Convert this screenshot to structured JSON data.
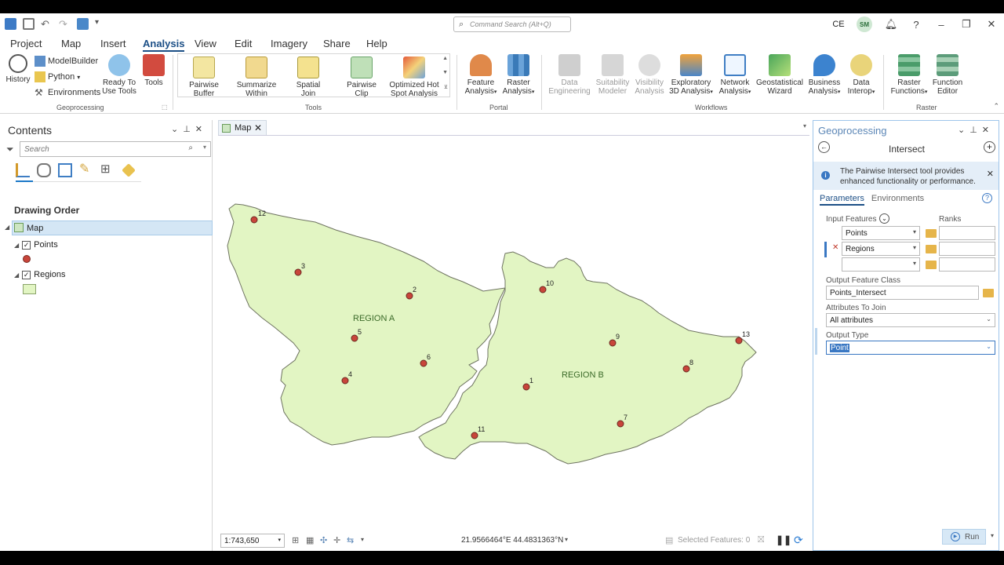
{
  "title_bar": {
    "command_search_placeholder": "Command Search (Alt+Q)",
    "user_initials": "CE",
    "avatar_initials": "SM",
    "icons": [
      "new-project-icon",
      "save-icon",
      "undo-icon",
      "redo-icon",
      "share-icon",
      "customize-icon",
      "notifications-icon",
      "help-icon",
      "minimize-icon",
      "restore-icon",
      "close-icon"
    ]
  },
  "menu": [
    "Project",
    "Map",
    "Insert",
    "Analysis",
    "View",
    "Edit",
    "Imagery",
    "Share",
    "Help"
  ],
  "menu_active": "Analysis",
  "ribbon": {
    "geoprocessing": {
      "label": "Geoprocessing",
      "history": "History",
      "modelbuilder": "ModelBuilder",
      "python": "Python",
      "environments": "Environments",
      "ready_to_use_line1": "Ready To",
      "ready_to_use_line2": "Use Tools",
      "tools": "Tools"
    },
    "tools_group": {
      "label": "Tools",
      "items": [
        {
          "line1": "Pairwise",
          "line2": "Buffer"
        },
        {
          "line1": "Summarize",
          "line2": "Within"
        },
        {
          "line1": "Spatial",
          "line2": "Join"
        },
        {
          "line1": "Pairwise",
          "line2": "Clip"
        },
        {
          "line1": "Optimized Hot",
          "line2": "Spot Analysis"
        }
      ]
    },
    "portal": {
      "label": "Portal",
      "items": [
        {
          "line1": "Feature",
          "line2": "Analysis"
        },
        {
          "line1": "Raster",
          "line2": "Analysis"
        }
      ]
    },
    "workflows": {
      "label": "Workflows",
      "items": [
        {
          "line1": "Data",
          "line2": "Engineering"
        },
        {
          "line1": "Suitability",
          "line2": "Modeler"
        },
        {
          "line1": "Visibility",
          "line2": "Analysis"
        },
        {
          "line1": "Exploratory",
          "line2": "3D Analysis"
        },
        {
          "line1": "Network",
          "line2": "Analysis"
        },
        {
          "line1": "Geostatistical",
          "line2": "Wizard"
        },
        {
          "line1": "Business",
          "line2": "Analysis"
        },
        {
          "line1": "Data",
          "line2": "Interop"
        }
      ]
    },
    "raster": {
      "label": "Raster",
      "items": [
        {
          "line1": "Raster",
          "line2": "Functions"
        },
        {
          "line1": "Function",
          "line2": "Editor"
        }
      ]
    }
  },
  "contents": {
    "title": "Contents",
    "search_placeholder": "Search",
    "drawing_order": "Drawing Order",
    "map_label": "Map",
    "layers": [
      {
        "name": "Points",
        "checked": true
      },
      {
        "name": "Regions",
        "checked": true
      }
    ],
    "point_color": "#c8453a",
    "region_color": "#e2f5c3"
  },
  "map_view": {
    "tab_label": "Map",
    "regions": [
      {
        "label": "REGION A"
      },
      {
        "label": "REGION B"
      }
    ],
    "point_labels": [
      "12",
      "3",
      "2",
      "10",
      "5",
      "6",
      "4",
      "1",
      "9",
      "8",
      "13",
      "11",
      "7"
    ],
    "scale": "1:743,650",
    "coordinates": "21.9566464°E 44.4831363°N",
    "selected_features": "Selected Features: 0"
  },
  "geoprocessing": {
    "title": "Geoprocessing",
    "tool": "Intersect",
    "info": "The Pairwise Intersect tool provides enhanced functionality or performance.",
    "tabs": [
      "Parameters",
      "Environments"
    ],
    "input_features_label": "Input Features",
    "ranks_label": "Ranks",
    "inputs": [
      "Points",
      "Regions",
      ""
    ],
    "output_feature_class_label": "Output Feature Class",
    "output_feature_class": "Points_Intersect",
    "attributes_label": "Attributes To Join",
    "attributes_value": "All attributes",
    "output_type_label": "Output Type",
    "output_type_value": "Point",
    "run_label": "Run"
  }
}
